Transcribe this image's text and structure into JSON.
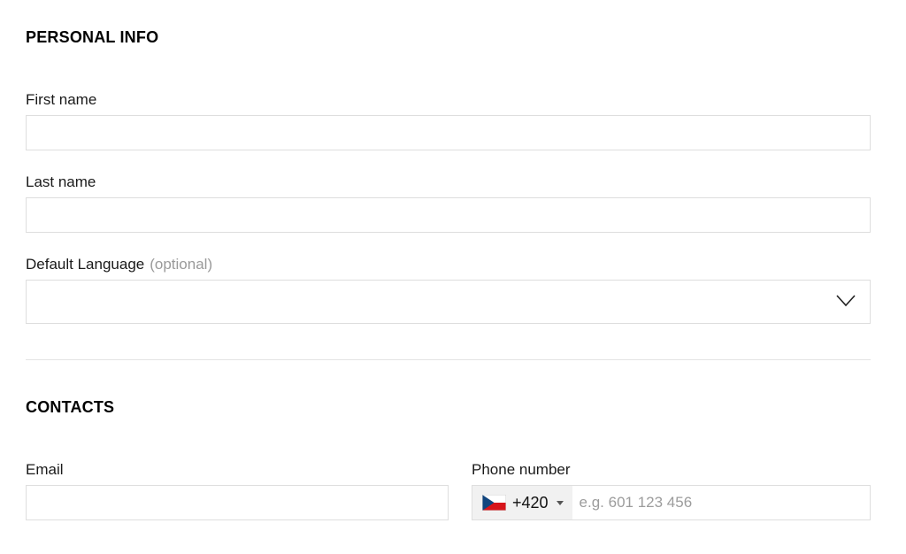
{
  "personal_info": {
    "title": "PERSONAL INFO",
    "first_name": {
      "label": "First name",
      "value": "",
      "placeholder": ""
    },
    "last_name": {
      "label": "Last name",
      "value": "",
      "placeholder": ""
    },
    "default_language": {
      "label": "Default Language",
      "optional_label": "(optional)",
      "selected": ""
    }
  },
  "contacts": {
    "title": "CONTACTS",
    "email": {
      "label": "Email",
      "value": "",
      "placeholder": ""
    },
    "phone": {
      "label": "Phone number",
      "country_flag_icon": "czech-flag-icon",
      "dial_code": "+420",
      "value": "",
      "placeholder": "e.g. 601 123 456"
    }
  },
  "colors": {
    "border": "#dedede",
    "divider": "#e4e4e4",
    "muted_text": "#9a9a9a",
    "country_select_bg": "#f1f1f1"
  }
}
